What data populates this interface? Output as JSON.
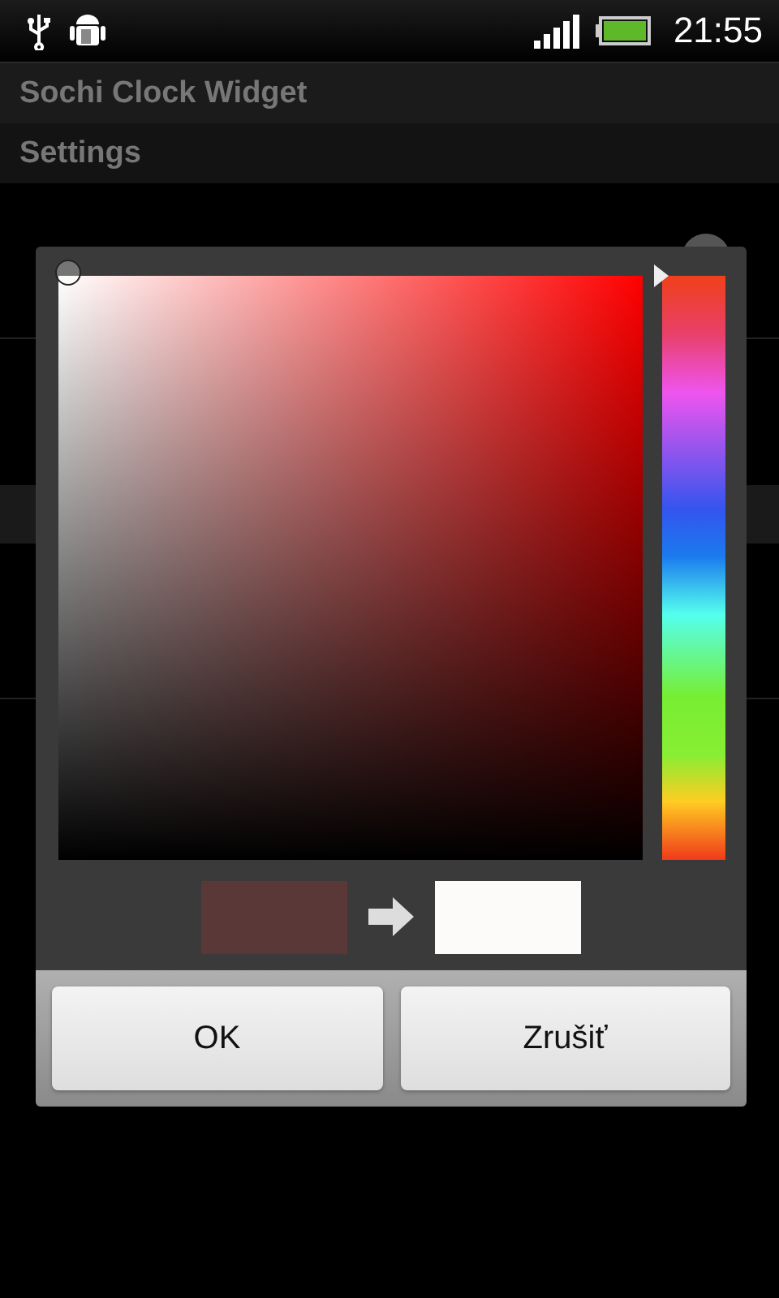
{
  "status_bar": {
    "time": "21:55"
  },
  "app_bar": {
    "title": "Sochi Clock Widget",
    "subtitle": "Settings"
  },
  "settings": [
    {
      "kind": "item"
    },
    {
      "kind": "item"
    },
    {
      "kind": "header"
    },
    {
      "kind": "item"
    }
  ],
  "dialog": {
    "preview": [
      {
        "kind": "old",
        "color": "#5a3838"
      },
      {
        "kind": "new",
        "color": "#fdfbfa"
      }
    ],
    "buttons": [
      "OK",
      "Zrušiť"
    ]
  }
}
